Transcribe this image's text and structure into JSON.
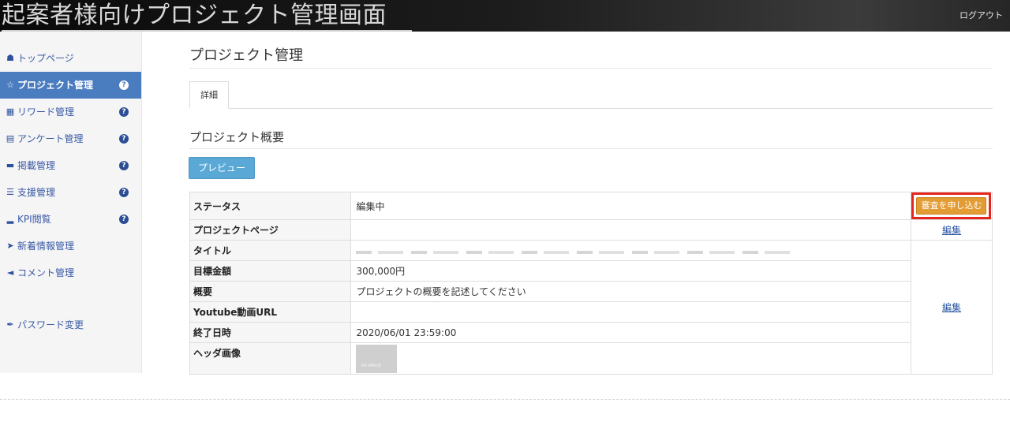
{
  "app": {
    "title": "起案者様向けプロジェクト管理画面",
    "logout": "ログアウト"
  },
  "sidebar": {
    "items": [
      {
        "icon": "home-icon",
        "label": "トップページ"
      },
      {
        "icon": "star-icon",
        "label": "プロジェクト管理",
        "active": true
      },
      {
        "icon": "gift-icon",
        "label": "リワード管理"
      },
      {
        "icon": "survey-icon",
        "label": "アンケート管理"
      },
      {
        "icon": "publish-icon",
        "label": "掲載管理"
      },
      {
        "icon": "list-icon",
        "label": "支援管理"
      },
      {
        "icon": "bar-chart-icon",
        "label": "KPI閲覧"
      },
      {
        "icon": "send-icon",
        "label": "新着情報管理"
      },
      {
        "icon": "megaphone-icon",
        "label": "コメント管理"
      },
      {
        "icon": "wrench-icon",
        "label": "パスワード変更"
      }
    ]
  },
  "main": {
    "page_title": "プロジェクト管理",
    "tab": "詳細",
    "section_title": "プロジェクト概要",
    "preview_button": "プレビュー",
    "submit_button": "審査を申し込む",
    "edit_label": "編集",
    "rows": [
      {
        "label": "ステータス",
        "value": "編集中"
      },
      {
        "label": "プロジェクトページ",
        "value": ""
      },
      {
        "label": "タイトル",
        "value": ""
      },
      {
        "label": "目標金額",
        "value": "300,000円"
      },
      {
        "label": "概要",
        "value": "プロジェクトの概要を記述してください"
      },
      {
        "label": "Youtube動画URL",
        "value": ""
      },
      {
        "label": "終了日時",
        "value": "2020/06/01 23:59:00"
      },
      {
        "label": "ヘッダ画像",
        "value": ""
      }
    ],
    "no_image_label": "NO IMAGE"
  },
  "colors": {
    "accent": "#4a7cc0",
    "submit": "#e39b34",
    "highlight": "#e5261e",
    "preview": "#5aa8d6"
  }
}
